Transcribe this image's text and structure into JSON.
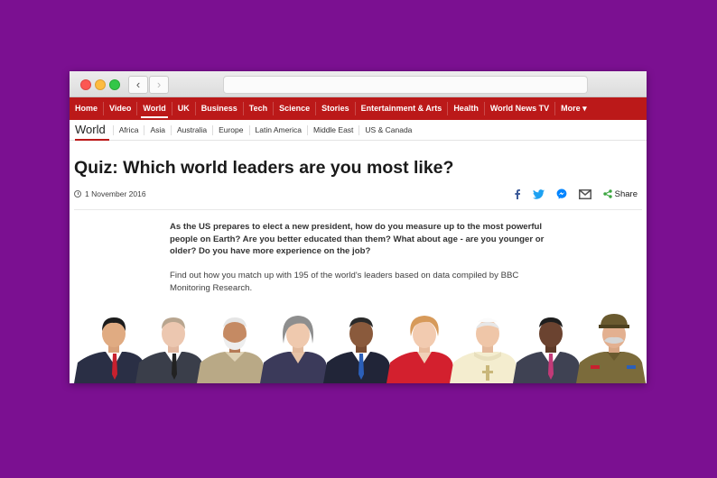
{
  "browser": {
    "back_icon": "chevron-left-icon",
    "forward_icon": "chevron-right-icon"
  },
  "nav": {
    "items": [
      {
        "label": "Home"
      },
      {
        "label": "Video"
      },
      {
        "label": "World",
        "active": true
      },
      {
        "label": "UK"
      },
      {
        "label": "Business"
      },
      {
        "label": "Tech"
      },
      {
        "label": "Science"
      },
      {
        "label": "Stories"
      },
      {
        "label": "Entertainment & Arts"
      },
      {
        "label": "Health"
      },
      {
        "label": "World News TV"
      },
      {
        "label": "More ▾"
      }
    ]
  },
  "subnav": {
    "section": "World",
    "items": [
      "Africa",
      "Asia",
      "Australia",
      "Europe",
      "Latin America",
      "Middle East",
      "US & Canada"
    ]
  },
  "article": {
    "title": "Quiz: Which world leaders are you most like?",
    "date": "1 November 2016",
    "intro": "As the US prepares to elect a new president, how do you measure up to the most powerful people on Earth? Are you better educated than them? What about age - are you younger or older? Do you have more experience on the job?",
    "body": "Find out how you match up with 195 of the world's leaders based on data compiled by BBC Monitoring Research."
  },
  "share": {
    "label": "Share",
    "icons": [
      "facebook-icon",
      "twitter-icon",
      "messenger-icon",
      "email-icon",
      "share-icon"
    ]
  },
  "colors": {
    "page_background": "#7b1091",
    "brand_red": "#bb1919",
    "facebook": "#3b5998",
    "twitter": "#1da1f2",
    "messenger": "#0084ff",
    "share_green": "#3ca640"
  }
}
